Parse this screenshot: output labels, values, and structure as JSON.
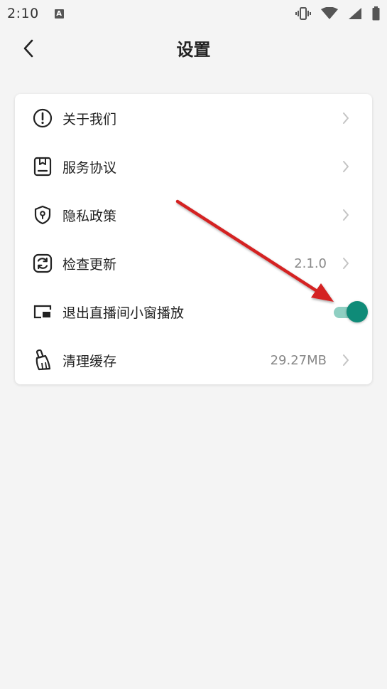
{
  "status_bar": {
    "time": "2:10",
    "a_badge": "A",
    "icons": [
      "vibrate-icon",
      "wifi-icon",
      "signal-icon",
      "battery-icon"
    ]
  },
  "header": {
    "title": "设置",
    "back_icon": "chevron-left-icon"
  },
  "settings": {
    "items": [
      {
        "label": "关于我们",
        "icon": "info-icon",
        "value": "",
        "control": "chevron"
      },
      {
        "label": "服务协议",
        "icon": "document-icon",
        "value": "",
        "control": "chevron"
      },
      {
        "label": "隐私政策",
        "icon": "shield-icon",
        "value": "",
        "control": "chevron"
      },
      {
        "label": "检查更新",
        "icon": "refresh-icon",
        "value": "2.1.0",
        "control": "chevron"
      },
      {
        "label": "退出直播间小窗播放",
        "icon": "picture-in-picture-icon",
        "value": "",
        "control": "toggle",
        "toggle_on": true
      },
      {
        "label": "清理缓存",
        "icon": "broom-icon",
        "value": "29.27MB",
        "control": "chevron"
      }
    ]
  },
  "colors": {
    "accent": "#0f8b78",
    "toggle_track": "#8fcfc2",
    "annotation_arrow": "#d42020",
    "background": "#f4f4f4"
  }
}
